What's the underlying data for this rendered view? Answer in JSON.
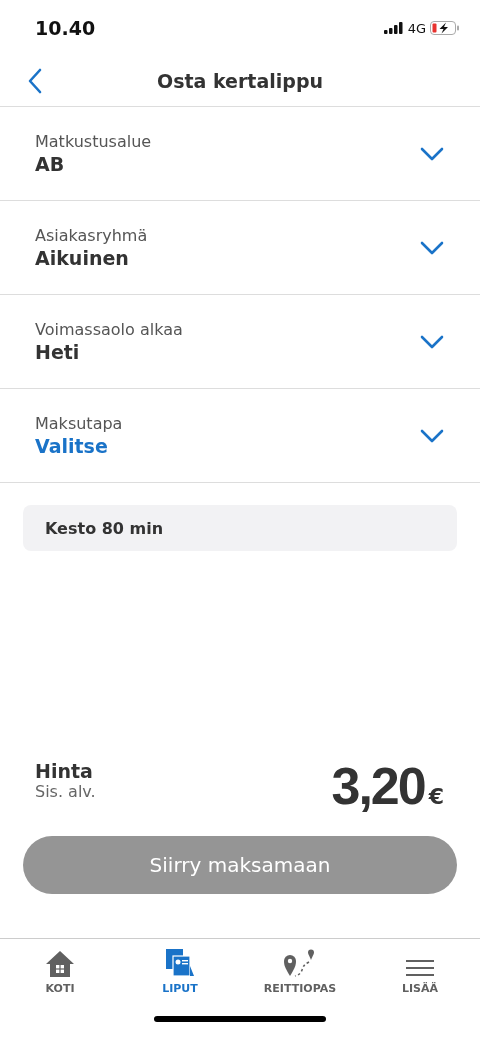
{
  "status_bar": {
    "time": "10.40",
    "network": "4G"
  },
  "header": {
    "title": "Osta kertalippu"
  },
  "fields": [
    {
      "label": "Matkustusalue",
      "value": "AB",
      "kind": "value"
    },
    {
      "label": "Asiakasryhmä",
      "value": "Aikuinen",
      "kind": "value"
    },
    {
      "label": "Voimassaolo alkaa",
      "value": "Heti",
      "kind": "value"
    },
    {
      "label": "Maksutapa",
      "value": "Valitse",
      "kind": "prompt"
    }
  ],
  "info": "Kesto 80 min",
  "price": {
    "label": "Hinta",
    "note": "Sis. alv.",
    "amount": "3,20",
    "currency": "€"
  },
  "pay_button": {
    "label": "Siirry maksamaan",
    "disabled": true
  },
  "tabs": [
    {
      "label": "KOTI",
      "kind": "home",
      "selected": false
    },
    {
      "label": "LIPUT",
      "kind": "tickets",
      "selected": true
    },
    {
      "label": "REITTIOPAS",
      "kind": "route",
      "selected": false
    },
    {
      "label": "LISÄÄ",
      "kind": "menu",
      "selected": false
    }
  ]
}
